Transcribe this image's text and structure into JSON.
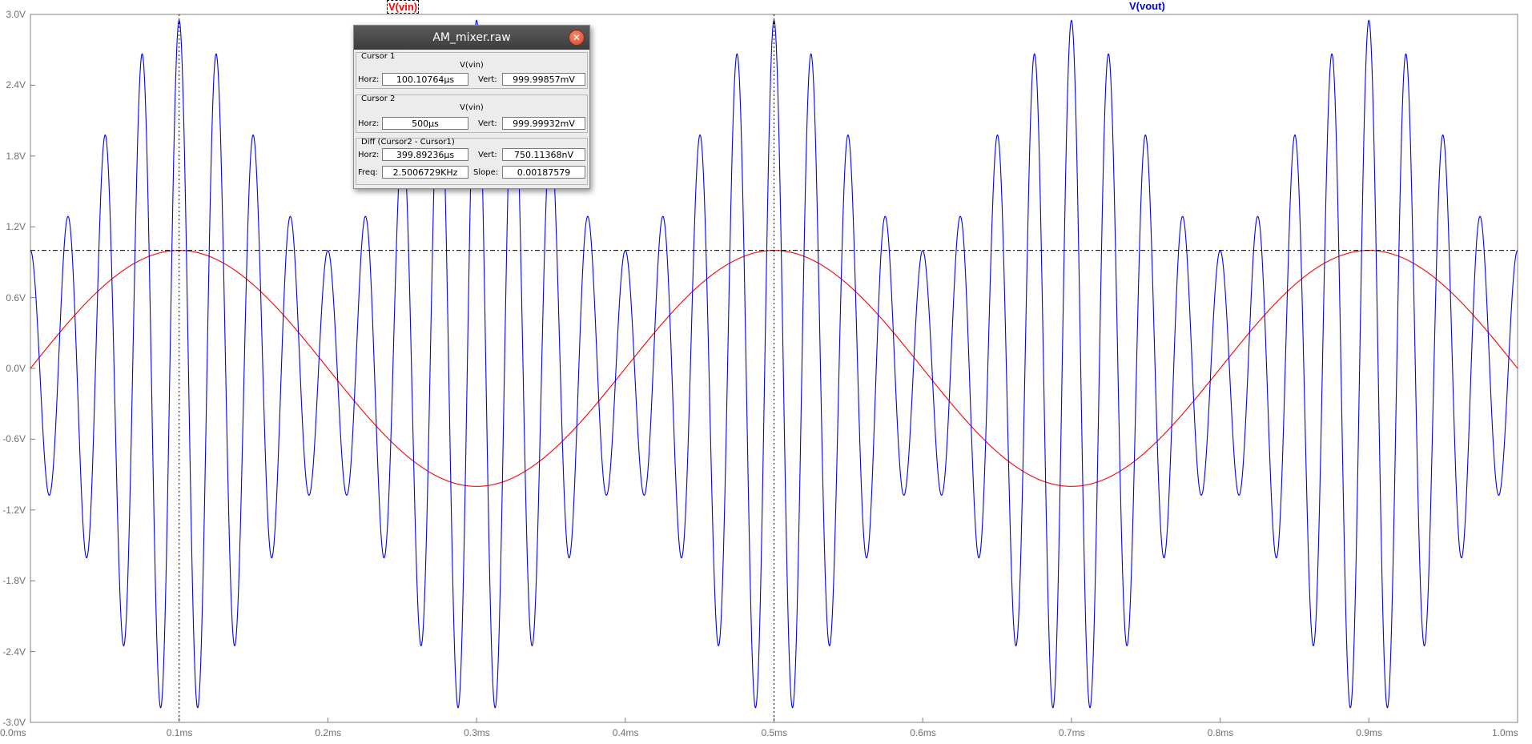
{
  "chart_data": {
    "type": "line",
    "title": "",
    "xlabel": "",
    "ylabel": "",
    "xlim": [
      0,
      1.0
    ],
    "ylim": [
      -3.0,
      3.0
    ],
    "x_ticks": [
      "0.0ms",
      "0.1ms",
      "0.2ms",
      "0.3ms",
      "0.4ms",
      "0.5ms",
      "0.6ms",
      "0.7ms",
      "0.8ms",
      "0.9ms",
      "1.0ms"
    ],
    "y_ticks": [
      "3.0V",
      "2.4V",
      "1.8V",
      "1.2V",
      "0.6V",
      "0.0V",
      "-0.6V",
      "-1.2V",
      "-1.8V",
      "-2.4V",
      "-3.0V"
    ],
    "series": [
      {
        "name": "V(vin)",
        "color": "#ff0000",
        "shape": "sine",
        "amplitude_V": 1.0,
        "frequency_kHz": 2.5,
        "x_start_ms": 0.0,
        "x_end_ms": 1.0
      },
      {
        "name": "V(vout)",
        "color": "#0000ff",
        "shape": "am_modulated",
        "carrier_frequency_kHz": 40,
        "modulation_frequency_kHz": 2.5,
        "envelope_max_V": 2.95,
        "envelope_min_V": 1.0,
        "x_start_ms": 0.0,
        "x_end_ms": 1.0
      }
    ],
    "cursors": [
      {
        "x_ms": 0.1,
        "style": "dotted"
      },
      {
        "x_ms": 0.5,
        "style": "dotted"
      }
    ],
    "reference_line": {
      "y_V": 1.0,
      "style": "dash-dot"
    },
    "grid": false,
    "legend": "top"
  },
  "dialog": {
    "title": "AM_mixer.raw",
    "cursor1": {
      "group": "Cursor 1",
      "signal": "V(vin)",
      "horz_label": "Horz:",
      "horz": "100.10764µs",
      "vert_label": "Vert:",
      "vert": "999.99857mV"
    },
    "cursor2": {
      "group": "Cursor 2",
      "signal": "V(vin)",
      "horz_label": "Horz:",
      "horz": "500µs",
      "vert_label": "Vert:",
      "vert": "999.99932mV"
    },
    "diff": {
      "group": "Diff (Cursor2 - Cursor1)",
      "horz_label": "Horz:",
      "horz": "399.89236µs",
      "vert_label": "Vert:",
      "vert": "750.11368nV",
      "freq_label": "Freq:",
      "freq": "2.5006729KHz",
      "slope_label": "Slope:",
      "slope": "0.00187579"
    }
  }
}
